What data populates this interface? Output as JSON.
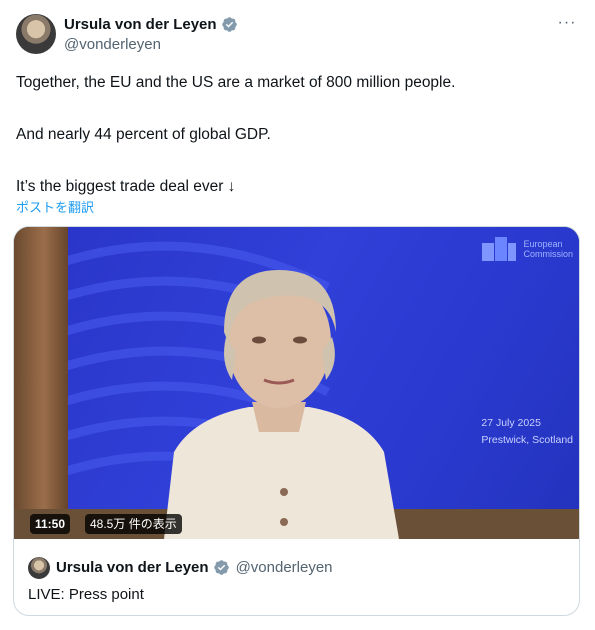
{
  "author": {
    "name": "Ursula von der Leyen",
    "handle": "@vonderleyen",
    "verified_icon": "verified-badge-icon"
  },
  "more_icon": "more-options-icon",
  "more_glyph": "···",
  "tweet": {
    "text": "Together, the EU and the US are a market of 800 million people.\n\nAnd nearly 44 percent of global GDP.\n\nIt’s the biggest trade deal ever ↓",
    "translate_label": "ポストを翻訳"
  },
  "video": {
    "duration": "11:50",
    "views": "48.5万 件の表示",
    "logo_line1": "European",
    "logo_line2": "Commission",
    "date_line1": "27 July 2025",
    "date_line2": "Prestwick, Scotland"
  },
  "quoted": {
    "name": "Ursula von der Leyen",
    "handle": "@vonderleyen",
    "text": "LIVE: Press point"
  },
  "colors": {
    "accent": "#1d9bf0",
    "verified": "#829aab",
    "screen_blue": "#2a36c9"
  }
}
